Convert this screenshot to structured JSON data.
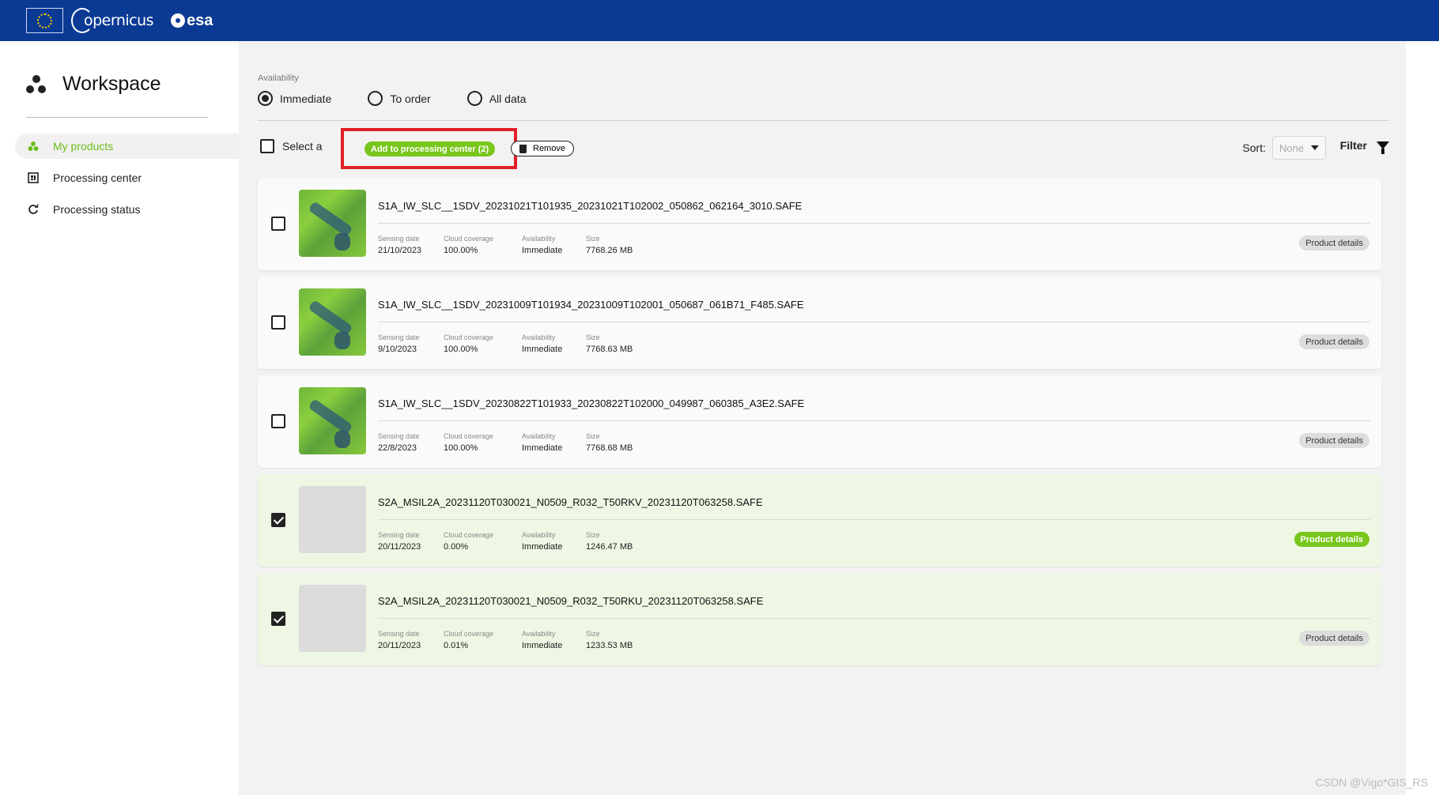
{
  "header": {
    "copernicus_label": "opernicus",
    "esa_label": "esa"
  },
  "sidebar": {
    "title": "Workspace",
    "items": [
      {
        "label": "My products",
        "active": true
      },
      {
        "label": "Processing center",
        "active": false
      },
      {
        "label": "Processing status",
        "active": false
      }
    ]
  },
  "filters": {
    "availability_label": "Availability",
    "options": [
      {
        "label": "Immediate",
        "selected": true
      },
      {
        "label": "To order",
        "selected": false
      },
      {
        "label": "All data",
        "selected": false
      }
    ]
  },
  "toolbar": {
    "select_all_label": "Select a",
    "add_label": "Add to processing center (2)",
    "remove_label": "Remove",
    "sort_label": "Sort:",
    "sort_value": "None",
    "filter_label": "Filter"
  },
  "meta_labels": {
    "date": "Sensing date",
    "cloud": "Cloud coverage",
    "availability": "Availability",
    "size": "Size"
  },
  "details_label": "Product details",
  "products": [
    {
      "name": "S1A_IW_SLC__1SDV_20231021T101935_20231021T102002_050862_062164_3010.SAFE",
      "date": "21/10/2023",
      "cloud": "100.00%",
      "availability": "Immediate",
      "size": "7768.26 MB",
      "checked": false
    },
    {
      "name": "S1A_IW_SLC__1SDV_20231009T101934_20231009T102001_050687_061B71_F485.SAFE",
      "date": "9/10/2023",
      "cloud": "100.00%",
      "availability": "Immediate",
      "size": "7768.63 MB",
      "checked": false
    },
    {
      "name": "S1A_IW_SLC__1SDV_20230822T101933_20230822T102000_049987_060385_A3E2.SAFE",
      "date": "22/8/2023",
      "cloud": "100.00%",
      "availability": "Immediate",
      "size": "7768.68 MB",
      "checked": false
    },
    {
      "name": "S2A_MSIL2A_20231120T030021_N0509_R032_T50RKV_20231120T063258.SAFE",
      "date": "20/11/2023",
      "cloud": "0.00%",
      "availability": "Immediate",
      "size": "1246.47 MB",
      "checked": true
    },
    {
      "name": "S2A_MSIL2A_20231120T030021_N0509_R032_T50RKU_20231120T063258.SAFE",
      "date": "20/11/2023",
      "cloud": "0.01%",
      "availability": "Immediate",
      "size": "1233.53 MB",
      "checked": true
    }
  ],
  "watermark": "CSDN @Vigo*GIS_RS",
  "colors": {
    "header": "#0b3a94",
    "accent": "#79c61d",
    "highlight": "#e0202a"
  }
}
